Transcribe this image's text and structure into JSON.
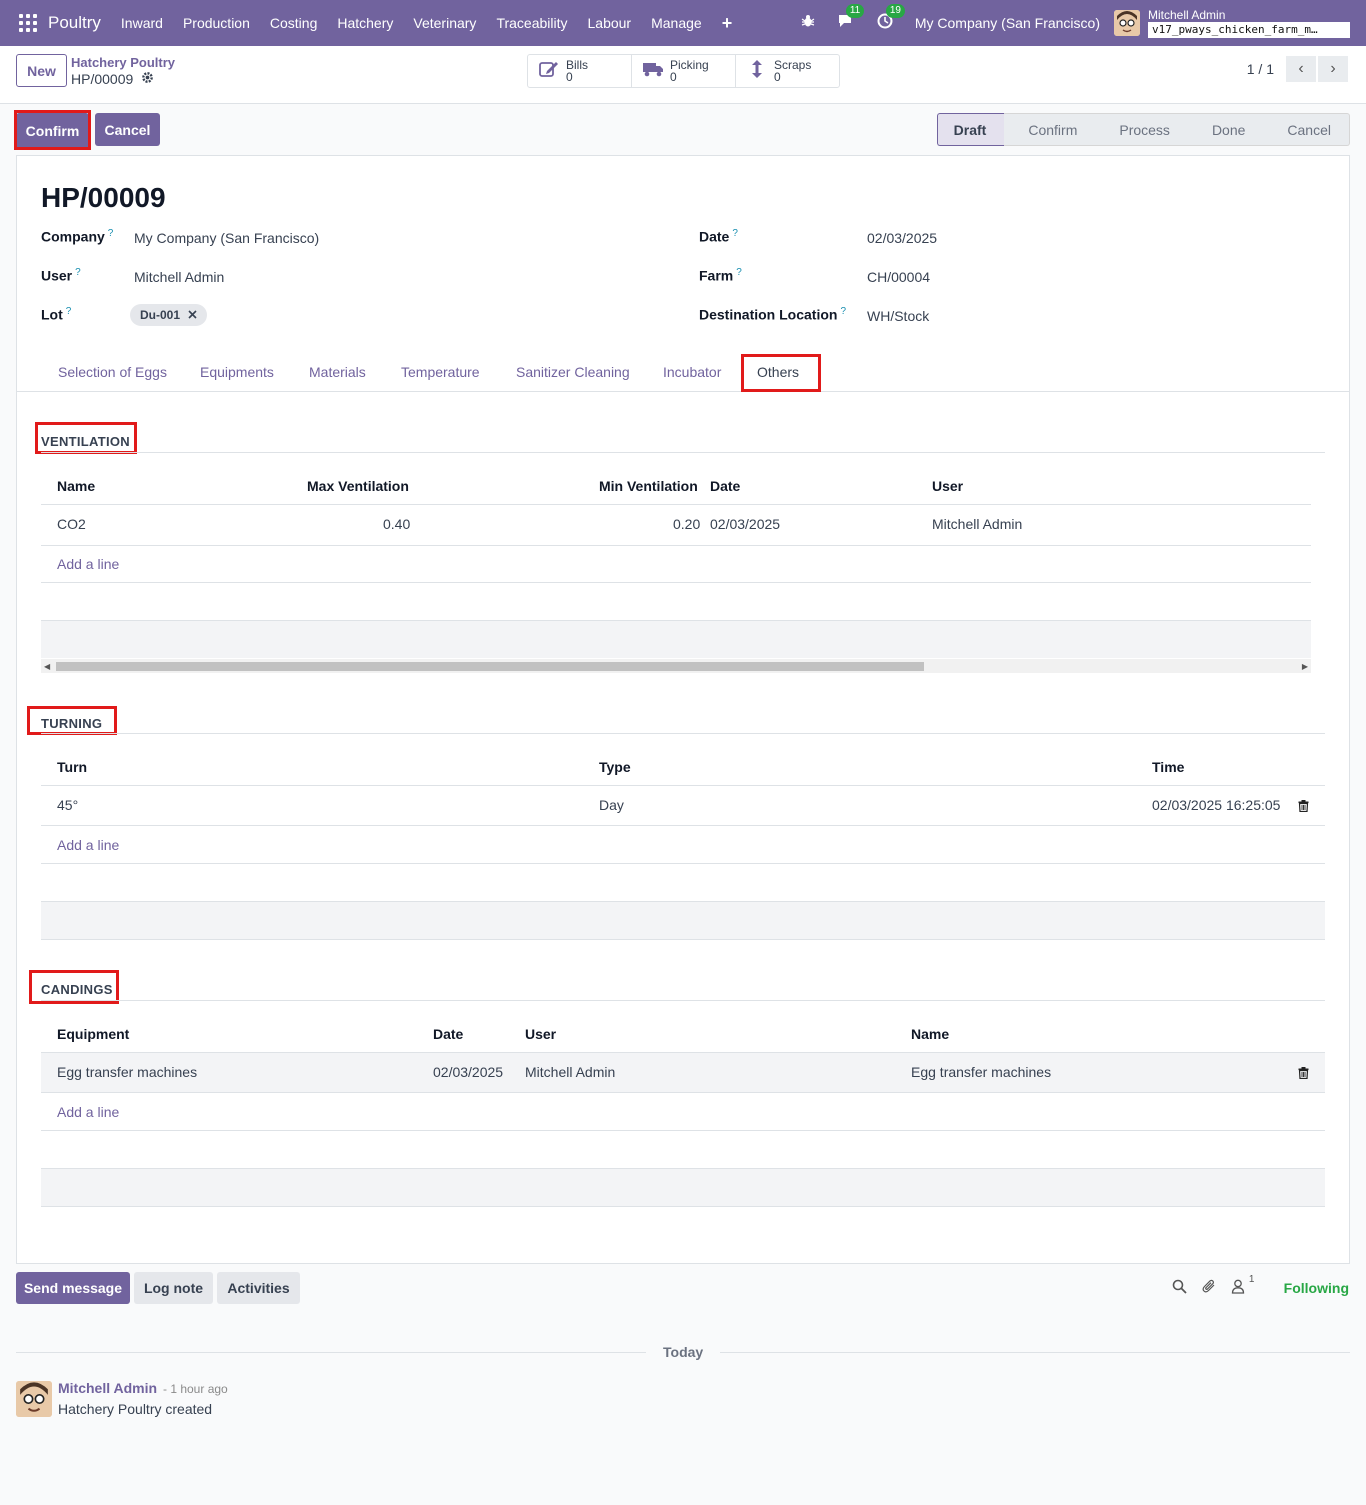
{
  "navbar": {
    "app_name": "Poultry",
    "menu": [
      "Inward",
      "Production",
      "Costing",
      "Hatchery",
      "Veterinary",
      "Traceability",
      "Labour",
      "Manage"
    ],
    "plus": "+",
    "messages_count": "11",
    "activities_count": "19",
    "company": "My Company (San Francisco)",
    "user_name": "Mitchell Admin",
    "database": "v17_pways_chicken_farm_m…"
  },
  "control_panel": {
    "new_label": "New",
    "breadcrumb_parent": "Hatchery Poultry",
    "breadcrumb_current": "HP/00009",
    "smart_buttons": [
      {
        "label": "Bills",
        "value": "0",
        "icon": "edit-icon"
      },
      {
        "label": "Picking",
        "value": "0",
        "icon": "truck-icon"
      },
      {
        "label": "Scraps",
        "value": "0",
        "icon": "arrows-vertical-icon"
      }
    ],
    "pager": "1 / 1"
  },
  "header": {
    "confirm_label": "Confirm",
    "cancel_label": "Cancel",
    "stages": [
      "Draft",
      "Confirm",
      "Process",
      "Done",
      "Cancel"
    ],
    "active_stage": "Draft"
  },
  "form": {
    "title": "HP/00009",
    "fields_left": [
      {
        "label": "Company",
        "value": "My Company (San Francisco)"
      },
      {
        "label": "User",
        "value": "Mitchell Admin"
      },
      {
        "label": "Lot",
        "value": "Du-001"
      }
    ],
    "fields_right": [
      {
        "label": "Date",
        "value": "02/03/2025"
      },
      {
        "label": "Farm",
        "value": "CH/00004"
      },
      {
        "label": "Destination Location",
        "value": "WH/Stock"
      }
    ],
    "help_mark": "?",
    "tabs": [
      "Selection of Eggs",
      "Equipments",
      "Materials",
      "Temperature",
      "Sanitizer Cleaning",
      "Incubator",
      "Others"
    ],
    "active_tab": "Others"
  },
  "ventilation": {
    "title": "VENTILATION",
    "columns": [
      "Name",
      "Max Ventilation",
      "Min Ventilation",
      "Date",
      "User"
    ],
    "rows": [
      {
        "name": "CO2",
        "max": "0.40",
        "min": "0.20",
        "date": "02/03/2025",
        "user": "Mitchell Admin"
      }
    ],
    "add_line": "Add a line"
  },
  "turning": {
    "title": "TURNING",
    "columns": [
      "Turn",
      "Type",
      "Time"
    ],
    "rows": [
      {
        "turn": "45°",
        "type": "Day",
        "time": "02/03/2025 16:25:05"
      }
    ],
    "add_line": "Add a line"
  },
  "candings": {
    "title": "CANDINGS",
    "columns": [
      "Equipment",
      "Date",
      "User",
      "Name"
    ],
    "rows": [
      {
        "equipment": "Egg transfer machines",
        "date": "02/03/2025",
        "user": "Mitchell Admin",
        "name": "Egg transfer machines"
      }
    ],
    "add_line": "Add a line"
  },
  "chatter": {
    "send_message": "Send message",
    "log_note": "Log note",
    "activities": "Activities",
    "followers_count": "1",
    "following": "Following",
    "day_separator": "Today",
    "message": {
      "author": "Mitchell Admin",
      "time": "- 1 hour ago",
      "body": "Hatchery Poultry created"
    }
  },
  "colors": {
    "brand": "#71639e",
    "highlight": "#e11a1a",
    "following": "#28a745"
  }
}
